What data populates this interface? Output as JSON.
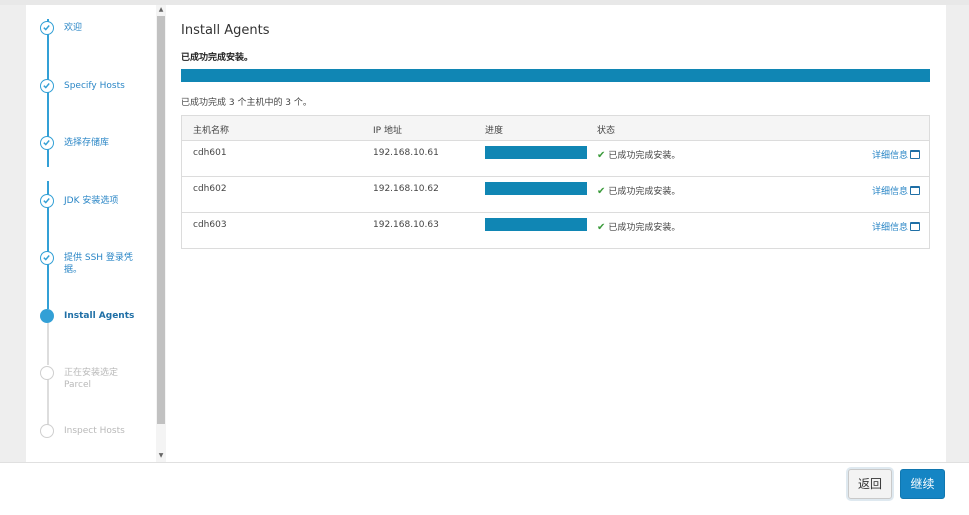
{
  "wizard": {
    "steps": [
      {
        "label": "欢迎",
        "state": "done"
      },
      {
        "label": "Specify Hosts",
        "state": "done"
      },
      {
        "label": "选择存储库",
        "state": "done"
      },
      {
        "label": "JDK 安装选项",
        "state": "done"
      },
      {
        "label": "提供 SSH 登录凭据。",
        "state": "done"
      },
      {
        "label": "Install Agents",
        "state": "current"
      },
      {
        "label": "正在安装选定 Parcel",
        "state": "pending"
      },
      {
        "label": "Inspect Hosts",
        "state": "pending"
      }
    ]
  },
  "main": {
    "title": "Install Agents",
    "status_message": "已成功完成安装。",
    "overall_progress": 1.0,
    "summary": "已成功完成 3 个主机中的 3 个。",
    "table": {
      "columns": [
        "主机名称",
        "IP 地址",
        "进度",
        "状态"
      ],
      "rows": [
        {
          "host": "cdh601",
          "ip": "192.168.10.61",
          "progress": 1.0,
          "status": "已成功完成安装。",
          "details": "详细信息"
        },
        {
          "host": "cdh602",
          "ip": "192.168.10.62",
          "progress": 1.0,
          "status": "已成功完成安装。",
          "details": "详细信息"
        },
        {
          "host": "cdh603",
          "ip": "192.168.10.63",
          "progress": 1.0,
          "status": "已成功完成安装。",
          "details": "详细信息"
        }
      ]
    }
  },
  "footer": {
    "back_label": "返回",
    "next_label": "继续"
  },
  "icons": {
    "step_done": "check-circle-icon",
    "step_current": "filled-circle-icon",
    "step_pending": "empty-circle-icon",
    "status_ok": "checkmark-icon",
    "details": "window-icon"
  },
  "colors": {
    "accent": "#33a0d6",
    "progress": "#1086b4",
    "success": "#3c9b3c",
    "primary_button": "#1585c4"
  }
}
